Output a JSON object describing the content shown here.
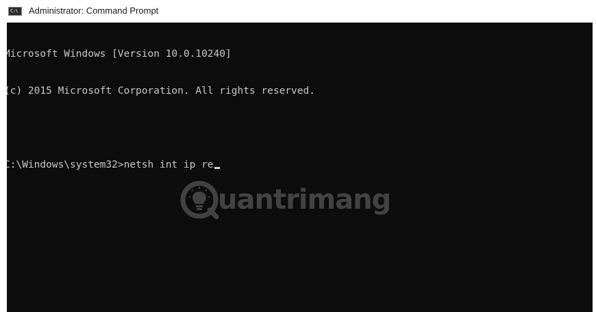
{
  "window": {
    "title": "Administrator: Command Prompt",
    "app_icon": "cmd-icon",
    "app_icon_glyph": "C:\\"
  },
  "console": {
    "background": "#0c0c0c",
    "foreground": "#c8c8c8",
    "lines": [
      "Microsoft Windows [Version 10.0.10240]",
      "(c) 2015 Microsoft Corporation. All rights reserved.",
      "",
      "C:\\Windows\\system32>netsh int ip re"
    ]
  },
  "watermark": {
    "text": "uantrimang",
    "icon": "lightbulb-q-icon"
  }
}
